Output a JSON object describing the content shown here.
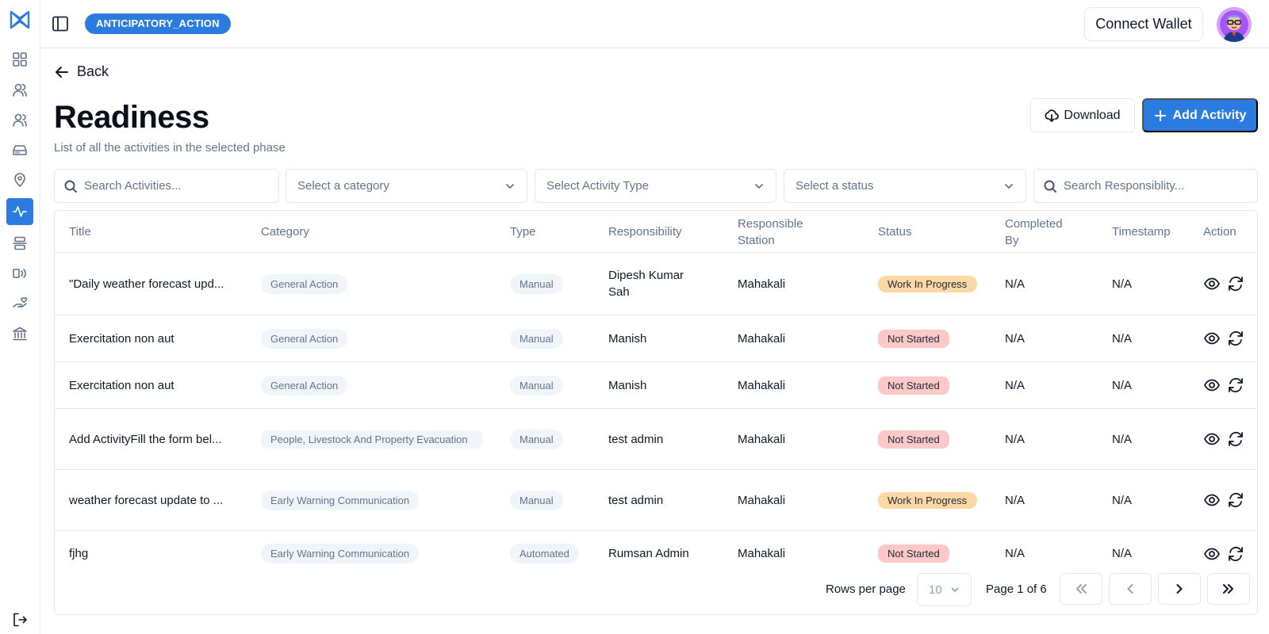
{
  "header": {
    "phase_badge": "ANTICIPATORY_ACTION",
    "connect_wallet": "Connect Wallet"
  },
  "sidebar": {
    "items": [
      {
        "icon": "dashboard-icon"
      },
      {
        "icon": "beneficiaries-icon"
      },
      {
        "icon": "groups-icon"
      },
      {
        "icon": "inbox-icon"
      },
      {
        "icon": "location-icon"
      },
      {
        "icon": "activity-icon",
        "active": true
      },
      {
        "icon": "layers-icon"
      },
      {
        "icon": "broadcast-icon"
      },
      {
        "icon": "aid-icon"
      },
      {
        "icon": "bank-icon"
      }
    ],
    "bottom_icon": "logout-icon"
  },
  "page": {
    "back_label": "Back",
    "title": "Readiness",
    "subtitle": "List of all the activities in the selected phase",
    "download_label": "Download",
    "add_activity_label": "Add Activity"
  },
  "filters": {
    "search_activities_placeholder": "Search Activities...",
    "category_placeholder": "Select a category",
    "activity_type_placeholder": "Select Activity Type",
    "status_placeholder": "Select a status",
    "search_responsibility_placeholder": "Search Responsiblity..."
  },
  "table": {
    "headers": {
      "title": "Title",
      "category": "Category",
      "type": "Type",
      "responsibility": "Responsibility",
      "responsible_station": "Responsible Station",
      "status": "Status",
      "completed_by": "Completed By",
      "timestamp": "Timestamp",
      "action": "Action"
    },
    "rows": [
      {
        "title": "\"Daily weather forecast upd...",
        "category": "General Action",
        "type": "Manual",
        "responsibility": "Dipesh Kumar Sah",
        "station": "Mahakali",
        "status": "Work In Progress",
        "completed_by": "N/A",
        "timestamp": "N/A"
      },
      {
        "title": "Exercitation non aut",
        "category": "General Action",
        "type": "Manual",
        "responsibility": "Manish",
        "station": "Mahakali",
        "status": "Not Started",
        "completed_by": "N/A",
        "timestamp": "N/A"
      },
      {
        "title": "Exercitation non aut",
        "category": "General Action",
        "type": "Manual",
        "responsibility": "Manish",
        "station": "Mahakali",
        "status": "Not Started",
        "completed_by": "N/A",
        "timestamp": "N/A"
      },
      {
        "title": "Add ActivityFill the form bel...",
        "category": "People, Livestock And Property Evacuation",
        "type": "Manual",
        "responsibility": "test admin",
        "station": "Mahakali",
        "status": "Not Started",
        "completed_by": "N/A",
        "timestamp": "N/A"
      },
      {
        "title": "weather forecast update to ...",
        "category": "Early Warning Communication",
        "type": "Manual",
        "responsibility": "test admin",
        "station": "Mahakali",
        "status": "Work In Progress",
        "completed_by": "N/A",
        "timestamp": "N/A"
      },
      {
        "title": "fjhg",
        "category": "Early Warning Communication",
        "type": "Automated",
        "responsibility": "Rumsan Admin",
        "station": "Mahakali",
        "status": "Not Started",
        "completed_by": "N/A",
        "timestamp": "N/A"
      }
    ]
  },
  "pagination": {
    "rows_per_page_label": "Rows per page",
    "rows_per_page_value": "10",
    "page_info": "Page 1 of 6"
  },
  "colors": {
    "accent": "#2b7be0",
    "status_in_progress": "#fdd7a4",
    "status_not_started": "#fcc8c8"
  }
}
